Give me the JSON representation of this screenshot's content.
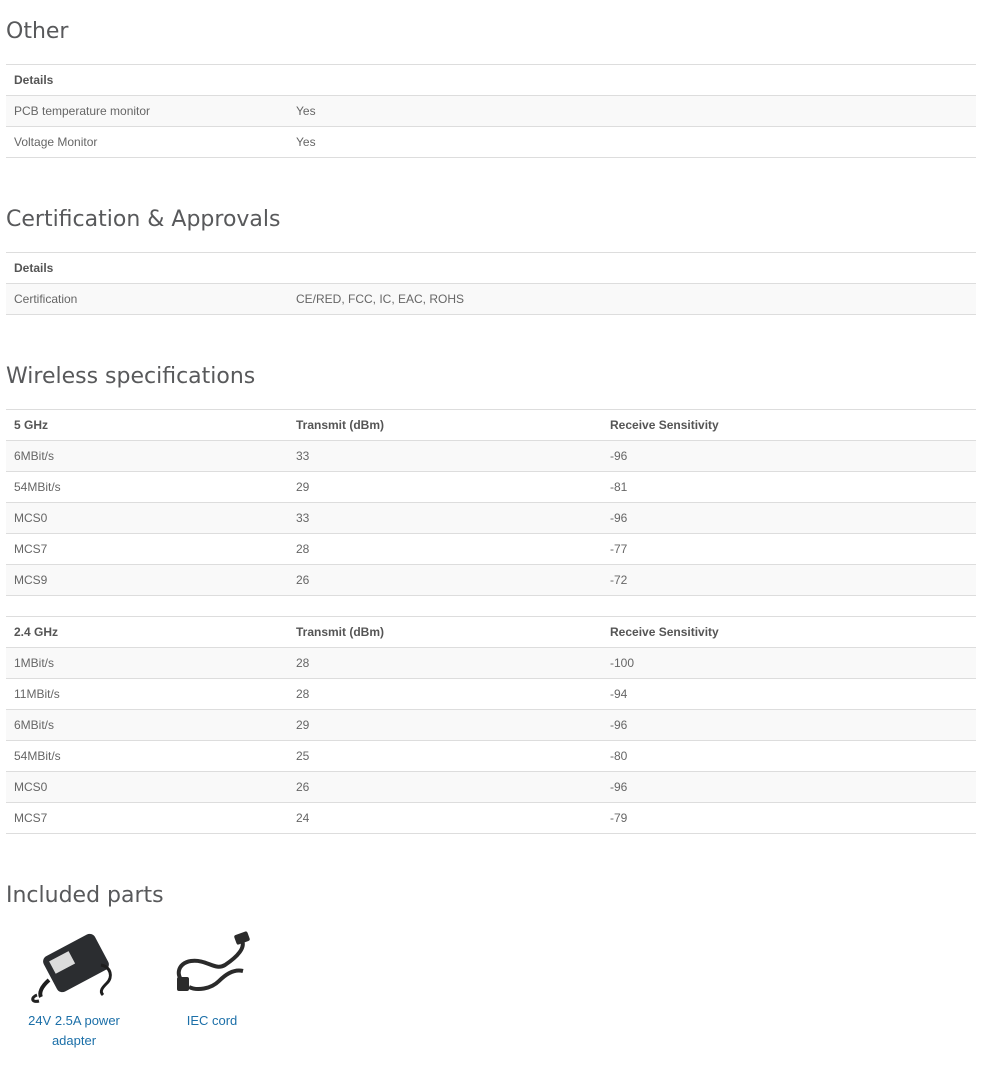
{
  "other": {
    "title": "Other",
    "header": "Details",
    "rows": [
      {
        "label": "PCB temperature monitor",
        "value": "Yes"
      },
      {
        "label": "Voltage Monitor",
        "value": "Yes"
      }
    ]
  },
  "certification": {
    "title": "Certification & Approvals",
    "header": "Details",
    "rows": [
      {
        "label": "Certification",
        "value": "CE/RED, FCC, IC, EAC, ROHS"
      }
    ]
  },
  "wireless": {
    "title": "Wireless specifications",
    "band5": {
      "headers": [
        "5 GHz",
        "Transmit (dBm)",
        "Receive Sensitivity"
      ],
      "rows": [
        [
          "6MBit/s",
          "33",
          "-96"
        ],
        [
          "54MBit/s",
          "29",
          "-81"
        ],
        [
          "MCS0",
          "33",
          "-96"
        ],
        [
          "MCS7",
          "28",
          "-77"
        ],
        [
          "MCS9",
          "26",
          "-72"
        ]
      ]
    },
    "band24": {
      "headers": [
        "2.4 GHz",
        "Transmit (dBm)",
        "Receive Sensitivity"
      ],
      "rows": [
        [
          "1MBit/s",
          "28",
          "-100"
        ],
        [
          "11MBit/s",
          "28",
          "-94"
        ],
        [
          "6MBit/s",
          "29",
          "-96"
        ],
        [
          "54MBit/s",
          "25",
          "-80"
        ],
        [
          "MCS0",
          "26",
          "-96"
        ],
        [
          "MCS7",
          "24",
          "-79"
        ]
      ]
    }
  },
  "included": {
    "title": "Included parts",
    "items": [
      {
        "label": "24V 2.5A power adapter",
        "icon": "power-adapter-icon"
      },
      {
        "label": "IEC cord",
        "icon": "power-cord-icon"
      }
    ]
  },
  "colors": {
    "link": "#1b6fa8",
    "heading": "#58595b",
    "border": "#dddddd",
    "stripe": "#f9f9f9"
  }
}
